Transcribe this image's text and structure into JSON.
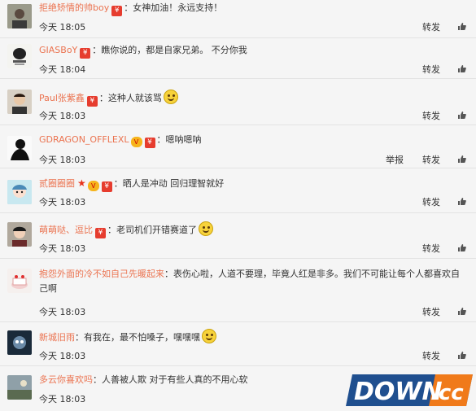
{
  "comments": [
    {
      "name": "拒绝矫情的帅boy",
      "text": "：女神加油！永远支持！",
      "time": "今天 18:05",
      "forward": "转发",
      "avatar": "avatar-photo-1"
    },
    {
      "name": "GIASBoY",
      "text": "：瞧你说的，都是自家兄弟。 不分你我",
      "time": "今天 18:04",
      "forward": "转发",
      "avatar": "avatar-logo"
    },
    {
      "name": "Paul张紫鑫",
      "text": "：这种人就该骂",
      "time": "今天 18:03",
      "forward": "转发",
      "avatar": "avatar-photo-2"
    },
    {
      "name": "GDRAGON_OFFLEXL",
      "text": "：嗯呐嗯呐",
      "time": "今天 18:03",
      "report": "举报",
      "forward": "转发",
      "avatar": "avatar-silhouette"
    },
    {
      "name": "贰圈圈圈",
      "text": "：晒人是冲动 回归理智就好",
      "time": "今天 18:03",
      "forward": "转发",
      "avatar": "avatar-cartoon"
    },
    {
      "name": "萌萌哒、逗比",
      "text": "：老司机们开错赛道了",
      "time": "今天 18:03",
      "forward": "转发",
      "avatar": "avatar-photo-3"
    },
    {
      "name": "抱怨外面的冷不如自己先暖起来",
      "text": "：表伤心啦，人道不要理，毕竟人红是非多。我们不可能让每个人都喜欢自己啊",
      "time": "今天 18:03",
      "forward": "转发",
      "avatar": "avatar-cake"
    },
    {
      "name": "新城旧雨",
      "text": "：有我在，最不怕嗓子，嘿嘿嘿",
      "time": "今天 18:03",
      "forward": "转发",
      "avatar": "avatar-doll"
    },
    {
      "name": "多云你喜欢吗",
      "text": "：人善被人欺 对于有些人真的不用心软",
      "time": "今天 18:03",
      "forward": "转发",
      "avatar": "avatar-landscape"
    }
  ],
  "icons": {
    "badge": "red-envelope-badge",
    "vip": "vip-badge",
    "star": "star-badge",
    "like": "thumbs-up-icon",
    "emoji": "emoji-icon"
  },
  "colors": {
    "name": "#eb7350",
    "text": "#333333",
    "badge": "#e63c2e",
    "background": "#f5f5f5"
  },
  "watermark": {
    "brand": "DOWN",
    "tld": ".cc"
  }
}
